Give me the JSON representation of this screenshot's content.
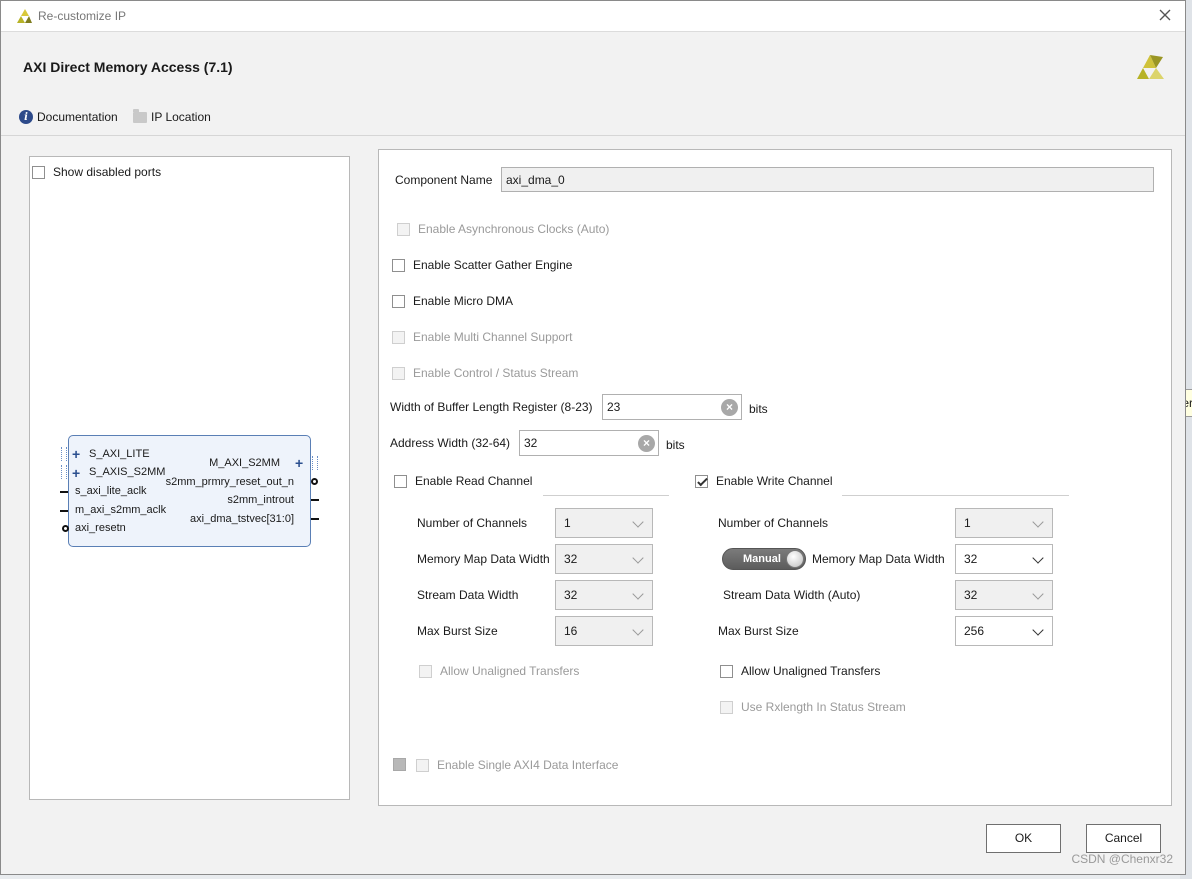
{
  "window": {
    "title": "Re-customize IP"
  },
  "header": {
    "ip_title": "AXI Direct Memory Access (7.1)",
    "doc_link": "Documentation",
    "location_link": "IP Location"
  },
  "left": {
    "show_disabled_ports": "Show disabled ports",
    "ports_left": [
      "S_AXI_LITE",
      "S_AXIS_S2MM",
      "s_axi_lite_aclk",
      "m_axi_s2mm_aclk",
      "axi_resetn"
    ],
    "ports_right": [
      "M_AXI_S2MM",
      "s2mm_prmry_reset_out_n",
      "s2mm_introut",
      "axi_dma_tstvec[31:0]"
    ]
  },
  "form": {
    "component_name_label": "Component Name",
    "component_name_value": "axi_dma_0",
    "async_clocks": "Enable Asynchronous Clocks (Auto)",
    "scatter_gather": "Enable Scatter Gather Engine",
    "micro_dma": "Enable Micro DMA",
    "multi_channel": "Enable Multi Channel Support",
    "control_status": "Enable Control / Status Stream",
    "buffer_len_label": "Width of Buffer Length Register (8-23)",
    "buffer_len_value": "23",
    "address_width_label": "Address Width (32-64)",
    "address_width_value": "32",
    "bits_unit": "bits",
    "single_axi4": "Enable Single AXI4 Data Interface"
  },
  "read_channel": {
    "enable": "Enable Read Channel",
    "enabled": false,
    "num_channels_label": "Number of Channels",
    "num_channels": "1",
    "mm_width_label": "Memory Map Data Width",
    "mm_width": "32",
    "stream_width_label": "Stream Data Width",
    "stream_width": "32",
    "burst_label": "Max Burst Size",
    "burst": "16",
    "unaligned": "Allow Unaligned Transfers"
  },
  "write_channel": {
    "enable": "Enable Write Channel",
    "enabled": true,
    "num_channels_label": "Number of Channels",
    "num_channels": "1",
    "manual_toggle": "Manual",
    "mm_width_label": "Memory Map Data Width",
    "mm_width": "32",
    "stream_width_label": "Stream Data Width (Auto)",
    "stream_width": "32",
    "burst_label": "Max Burst Size",
    "burst": "256",
    "unaligned": "Allow Unaligned Transfers",
    "rxlength": "Use Rxlength In Status Stream"
  },
  "buttons": {
    "ok": "OK",
    "cancel": "Cancel"
  },
  "background": {
    "tooltip": "Inter"
  },
  "watermark": "CSDN @Chenxr32",
  "colors": {
    "block_fill": "#eef3fb",
    "block_border": "#5a7fb5",
    "xilinx_logo": "#b7b327"
  }
}
